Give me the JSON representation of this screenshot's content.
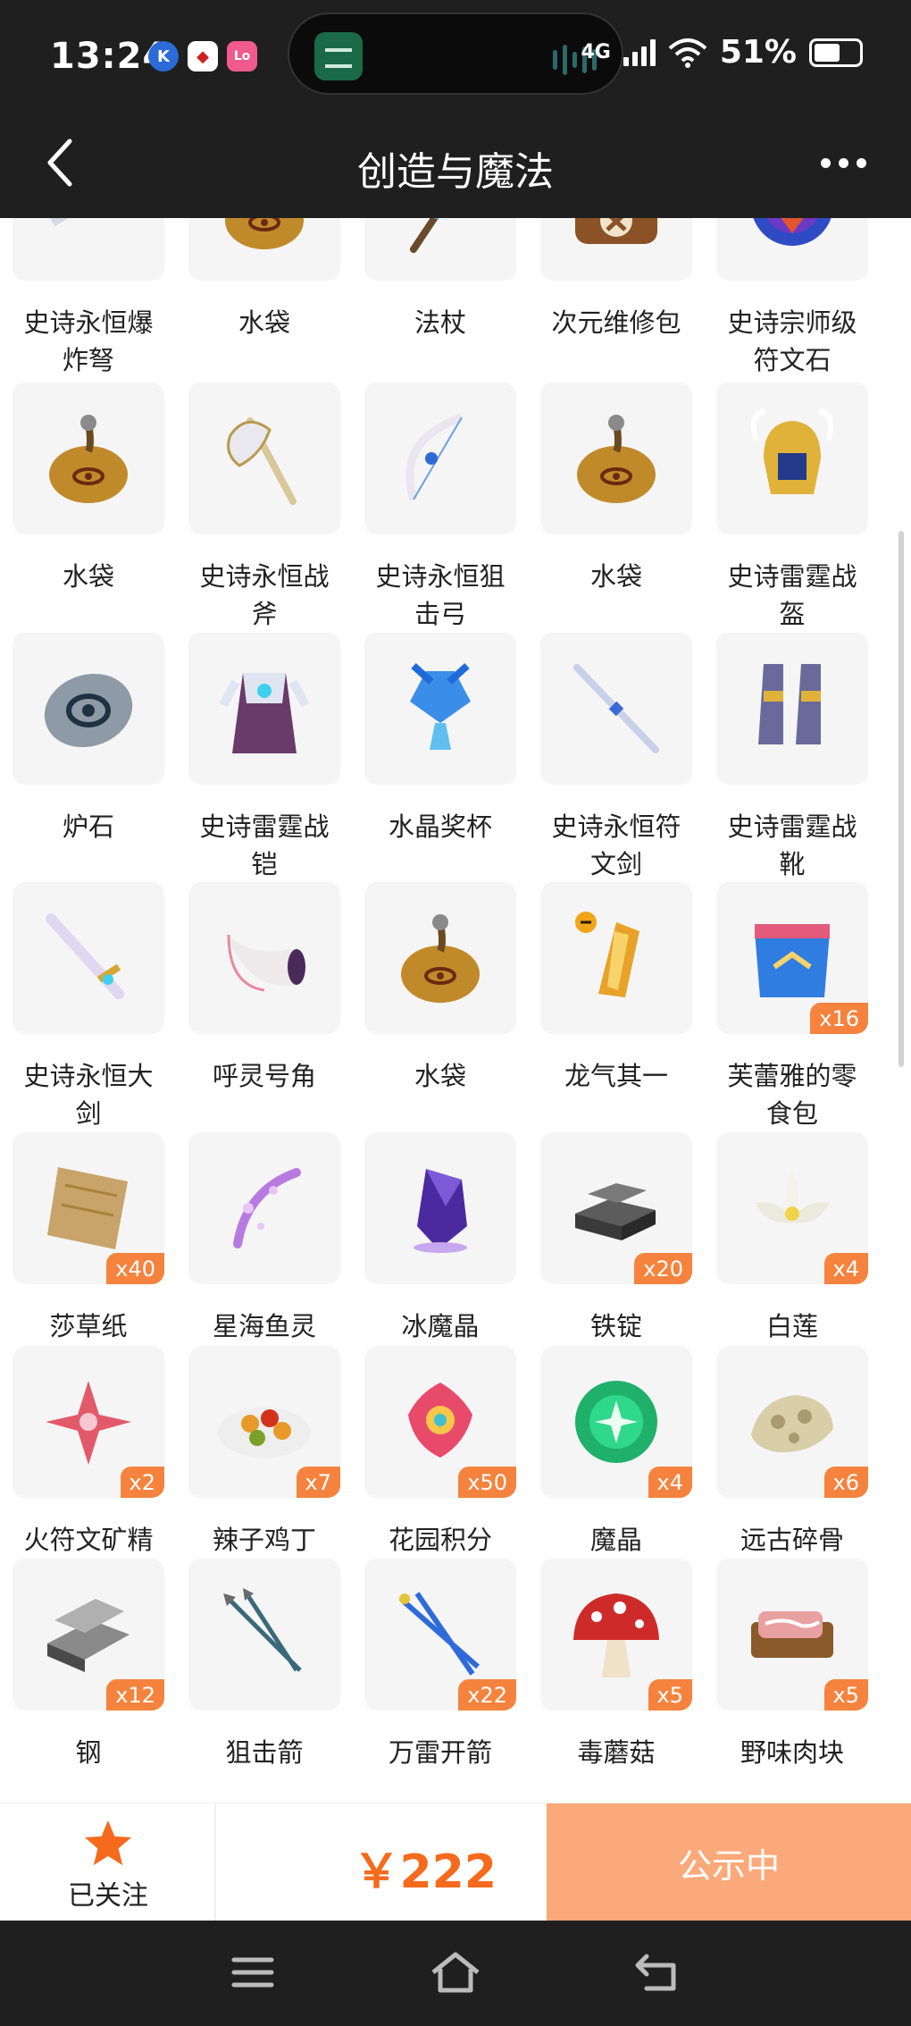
{
  "status_bar": {
    "time": "13:24",
    "network": "4G",
    "battery": "51%"
  },
  "nav": {
    "title": "创造与魔法"
  },
  "items": [
    {
      "name": "史诗永恒爆炸弩",
      "icon": "crossbow-icon"
    },
    {
      "name": "水袋",
      "icon": "water-bag-icon"
    },
    {
      "name": "法杖",
      "icon": "staff-icon"
    },
    {
      "name": "次元维修包",
      "icon": "repair-bag-icon"
    },
    {
      "name": "史诗宗师级符文石",
      "icon": "rune-stone-icon"
    },
    {
      "name": "水袋",
      "icon": "water-bag-icon"
    },
    {
      "name": "史诗永恒战斧",
      "icon": "battle-axe-icon"
    },
    {
      "name": "史诗永恒狙击弓",
      "icon": "bow-icon"
    },
    {
      "name": "水袋",
      "icon": "water-bag-icon"
    },
    {
      "name": "史诗雷霆战盔",
      "icon": "helmet-icon"
    },
    {
      "name": "炉石",
      "icon": "hearthstone-icon"
    },
    {
      "name": "史诗雷霆战铠",
      "icon": "armor-icon"
    },
    {
      "name": "水晶奖杯",
      "icon": "trophy-icon"
    },
    {
      "name": "史诗永恒符文剑",
      "icon": "rune-sword-icon"
    },
    {
      "name": "史诗雷霆战靴",
      "icon": "boots-icon"
    },
    {
      "name": "史诗永恒大剑",
      "icon": "greatsword-icon"
    },
    {
      "name": "呼灵号角",
      "icon": "horn-icon"
    },
    {
      "name": "水袋",
      "icon": "water-bag-icon"
    },
    {
      "name": "龙气其一",
      "icon": "dragon-qi-icon"
    },
    {
      "name": "芙蕾雅的零食包",
      "icon": "snack-bag-icon",
      "qty": "x16"
    },
    {
      "name": "莎草纸",
      "icon": "papyrus-icon",
      "qty": "x40"
    },
    {
      "name": "星海鱼灵",
      "icon": "star-fish-spirit-icon"
    },
    {
      "name": "冰魔晶",
      "icon": "ice-crystal-icon"
    },
    {
      "name": "铁锭",
      "icon": "iron-ingot-icon",
      "qty": "x20"
    },
    {
      "name": "白莲",
      "icon": "white-lotus-icon",
      "qty": "x4"
    },
    {
      "name": "火符文矿精",
      "icon": "fire-rune-ore-icon",
      "qty": "x2"
    },
    {
      "name": "辣子鸡丁",
      "icon": "spicy-chicken-icon",
      "qty": "x7"
    },
    {
      "name": "花园积分",
      "icon": "garden-points-icon",
      "qty": "x50"
    },
    {
      "name": "魔晶",
      "icon": "magic-crystal-icon",
      "qty": "x4"
    },
    {
      "name": "远古碎骨",
      "icon": "ancient-bone-icon",
      "qty": "x6"
    },
    {
      "name": "钢",
      "icon": "steel-icon",
      "qty": "x12"
    },
    {
      "name": "狙击箭",
      "icon": "sniper-arrow-icon"
    },
    {
      "name": "万雷开箭",
      "icon": "thunder-arrow-icon",
      "qty": "x22"
    },
    {
      "name": "毒蘑菇",
      "icon": "toadstool-icon",
      "qty": "x5"
    },
    {
      "name": "野味肉块",
      "icon": "game-meat-icon",
      "qty": "x5"
    }
  ],
  "bottom": {
    "follow_label": "已关注",
    "price": "￥222",
    "publish_label": "公示中"
  },
  "colors": {
    "accent": "#f56a1c",
    "publish_bg": "#fba97a",
    "bar_bg": "#1f1f1f"
  }
}
